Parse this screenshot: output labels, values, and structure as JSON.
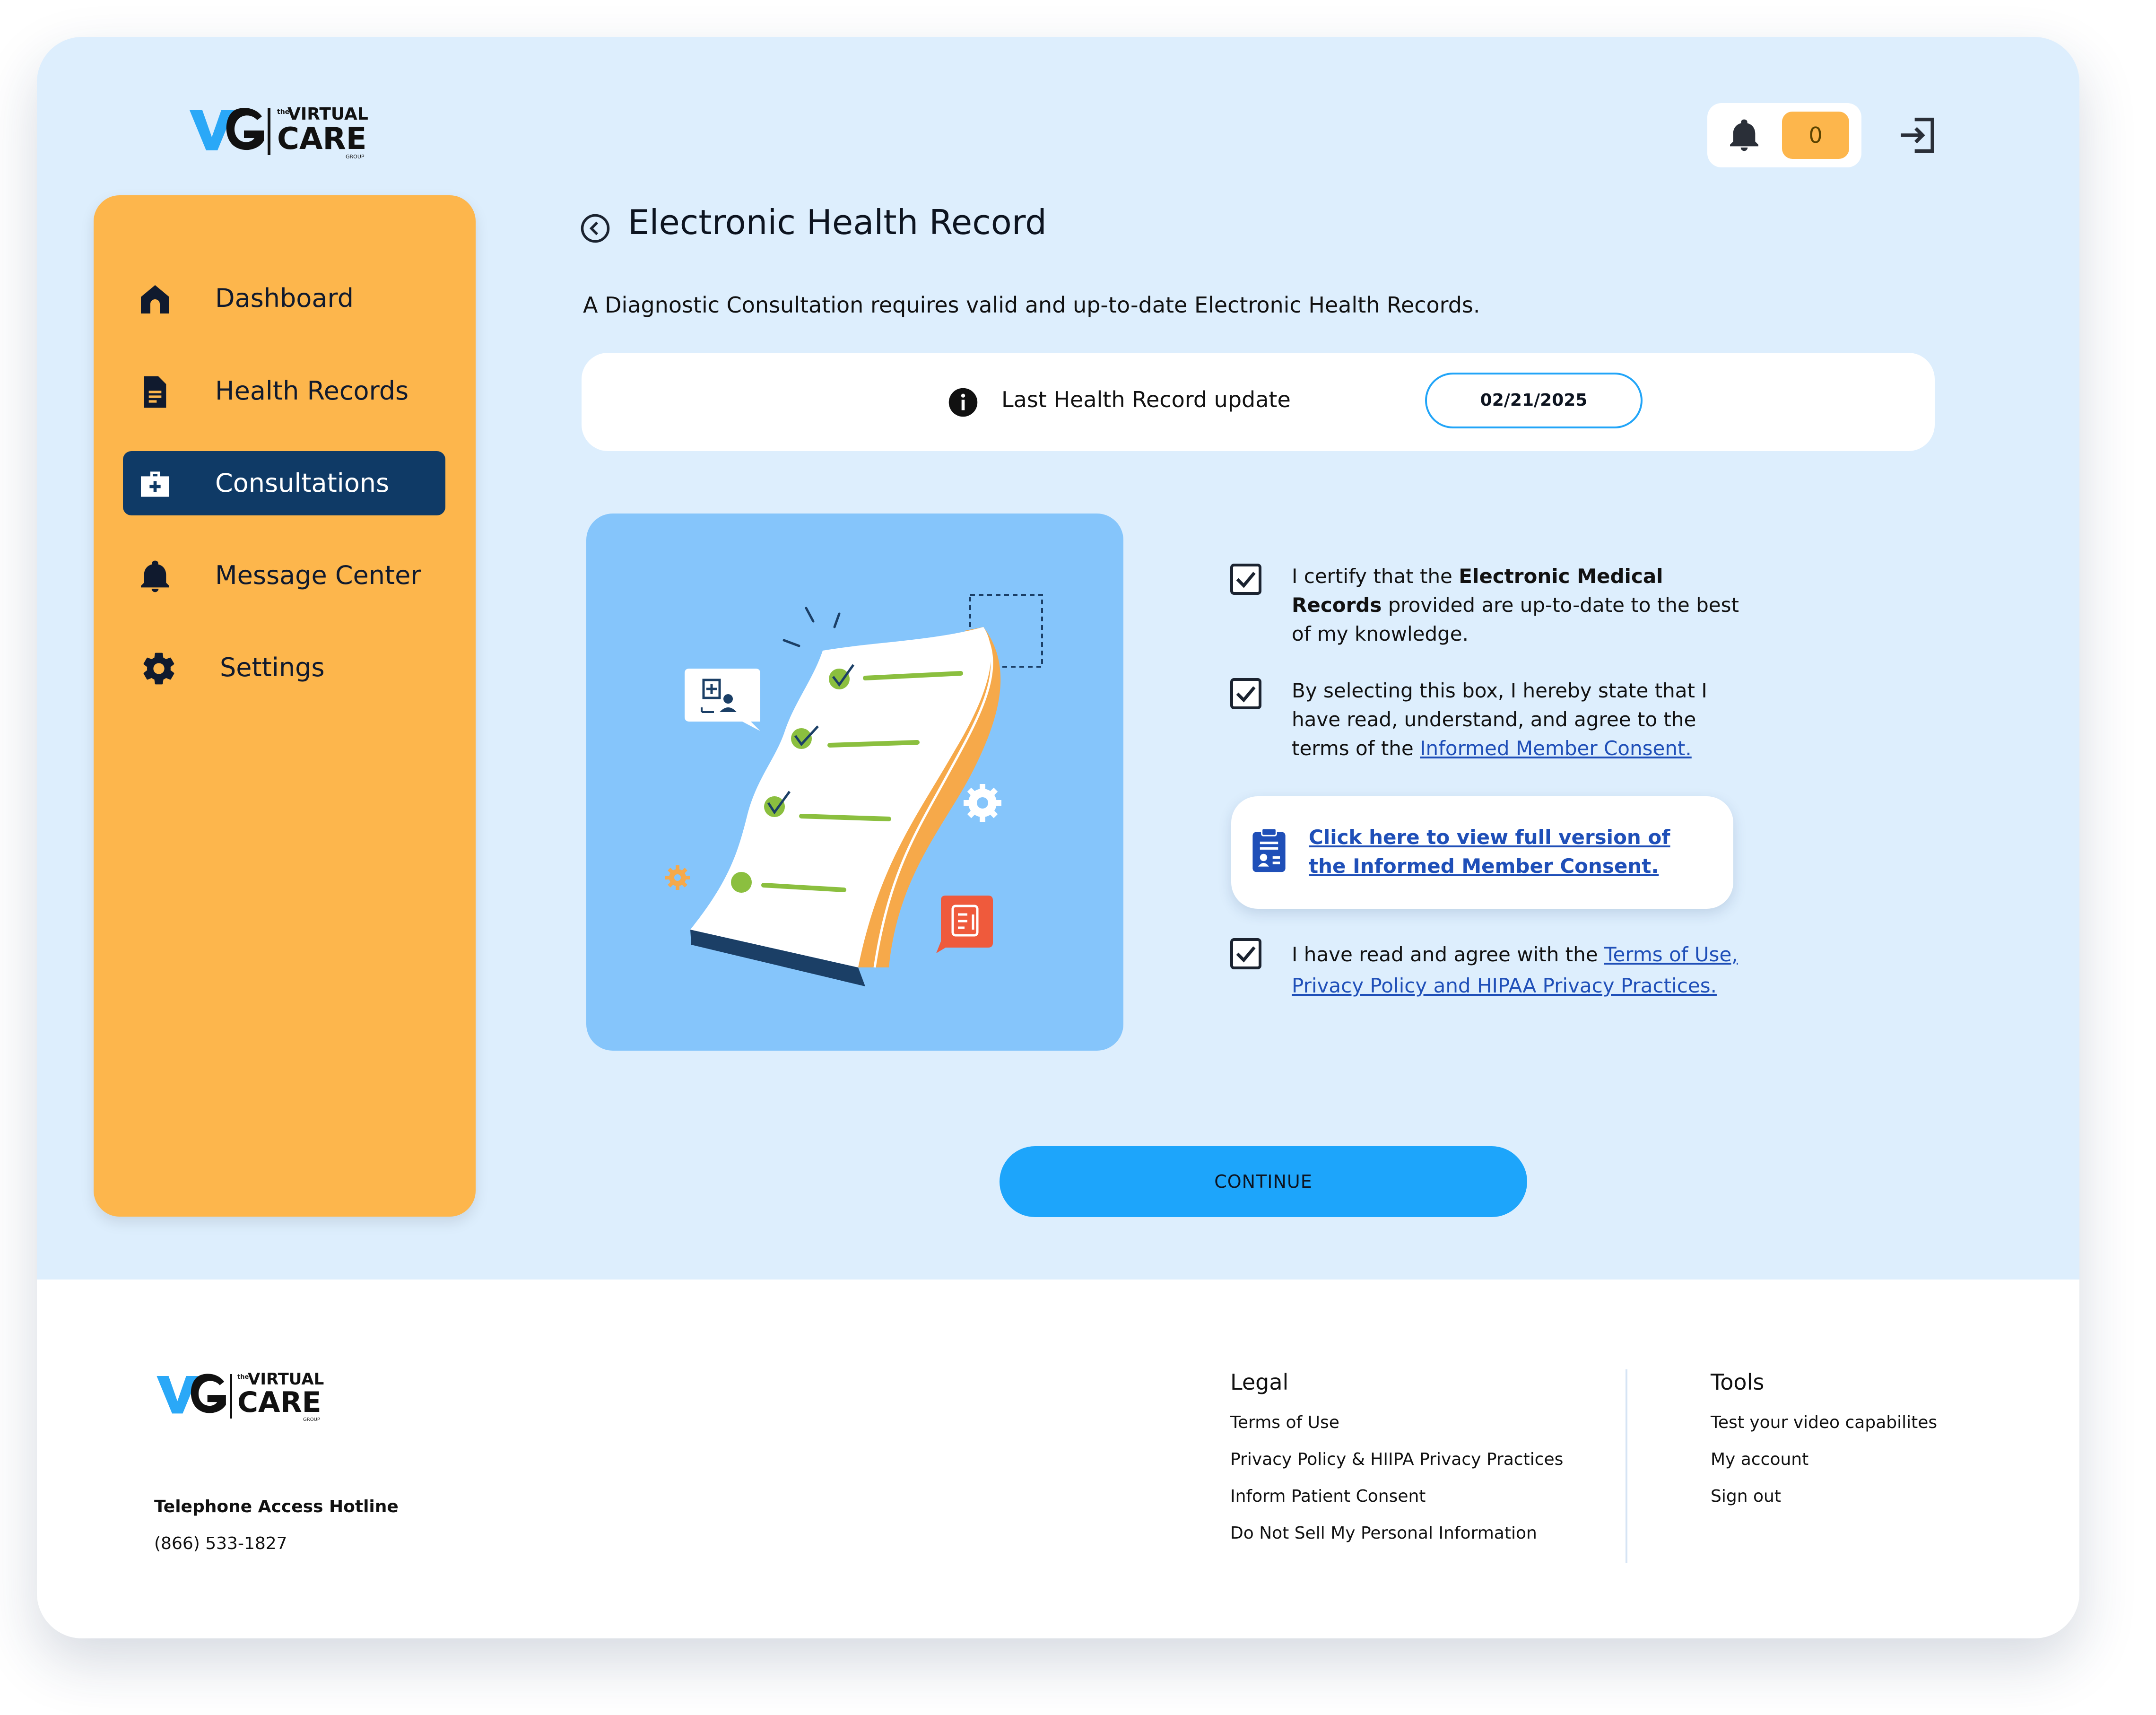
{
  "brand": {
    "logo_small_text": "the",
    "logo_name_top": "VIRTUAL",
    "logo_name_bottom": "CARE",
    "logo_group": "GROUP"
  },
  "header": {
    "notification_count": "0"
  },
  "sidebar": {
    "items": [
      {
        "label": "Dashboard",
        "icon": "home-icon"
      },
      {
        "label": "Health Records",
        "icon": "document-icon"
      },
      {
        "label": "Consultations",
        "icon": "medical-kit-icon",
        "active": true
      },
      {
        "label": "Message Center",
        "icon": "bell-icon"
      },
      {
        "label": "Settings",
        "icon": "gear-icon"
      }
    ]
  },
  "main": {
    "title": "Electronic Health Record",
    "subtitle": "A Diagnostic Consultation requires valid and up-to-date Electronic Health Records.",
    "record": {
      "label": "Last Health Record update",
      "date": "02/21/2025"
    },
    "cert1": {
      "pre": "I certify that the ",
      "bold": "Electronic Medical Records",
      "post": " provided are up-to-date to the best of my knowledge."
    },
    "cert2": {
      "pre": "By selecting this box, I hereby state that I have read, understand, and agree to the terms of the ",
      "link": "Informed Member Consent."
    },
    "consent_card": {
      "link": "Click here to view full version of the Informed Member Consent."
    },
    "cert3": {
      "pre": "I have read and agree with the ",
      "link": "Terms of Use, Privacy Policy and HIPAA Privacy Practices."
    },
    "continue_label": "CONTINUE"
  },
  "footer": {
    "hotline_label": "Telephone Access Hotline",
    "hotline_number": "(866) 533-1827",
    "legal": {
      "heading": "Legal",
      "links": [
        "Terms of Use",
        "Privacy Policy & HIIPA Privacy Practices",
        "Inform Patient Consent",
        "Do Not Sell My Personal Information"
      ]
    },
    "tools": {
      "heading": "Tools",
      "links": [
        "Test your video capabilites",
        "My account",
        "Sign out"
      ]
    }
  },
  "colors": {
    "hero_bg": "#ddeefd",
    "sidebar_bg": "#fdb64c",
    "active_nav": "#0f3a66",
    "button": "#1da5fb",
    "illustration_bg": "#85c5fb",
    "link": "#1f4fb8"
  }
}
